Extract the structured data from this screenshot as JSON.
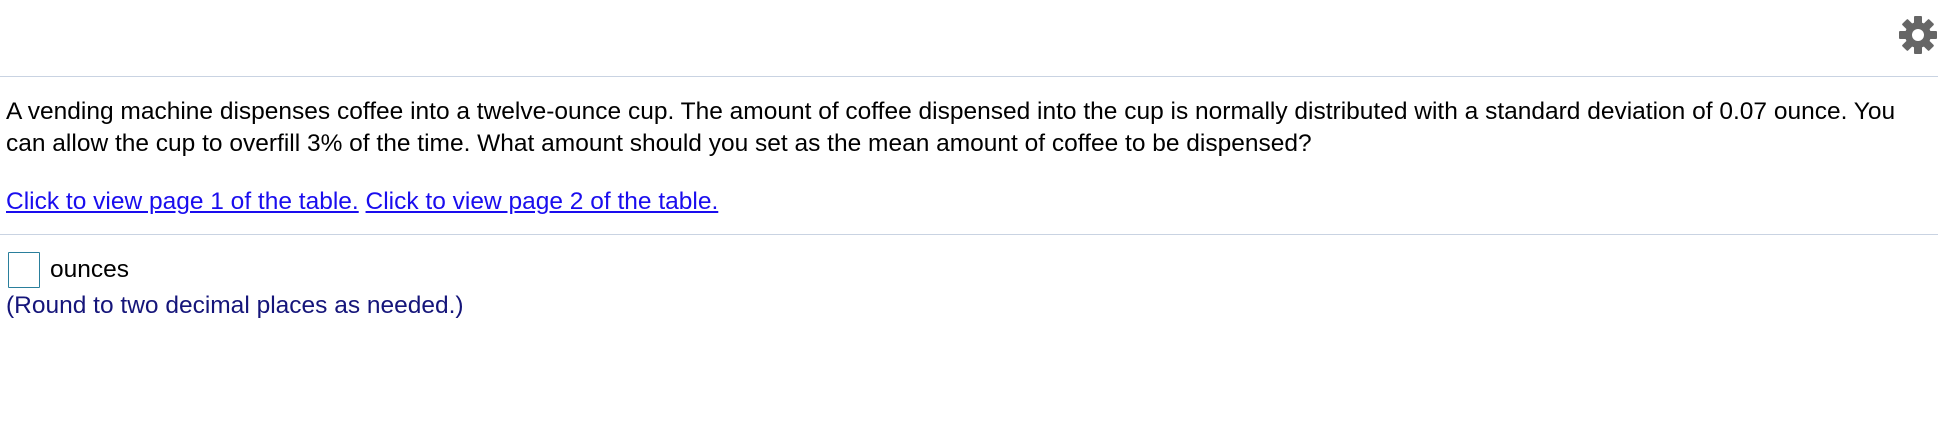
{
  "header": {
    "settings_icon": "gear-icon",
    "icon_color": "#666666"
  },
  "question": {
    "text": "A vending machine dispenses coffee into a twelve-ounce cup. The amount of coffee dispensed into the cup is normally distributed with a standard deviation of 0.07 ounce. You can allow the cup to overfill 3% of the time. What amount should you set as the mean amount of coffee to be dispensed?"
  },
  "links": {
    "page1_label": "Click to view page 1 of the table.",
    "page2_label": "Click to view page 2 of the table.",
    "color": "#1a0dee"
  },
  "answer": {
    "value": "",
    "unit": "ounces",
    "hint": "(Round to two decimal places as needed.)"
  }
}
